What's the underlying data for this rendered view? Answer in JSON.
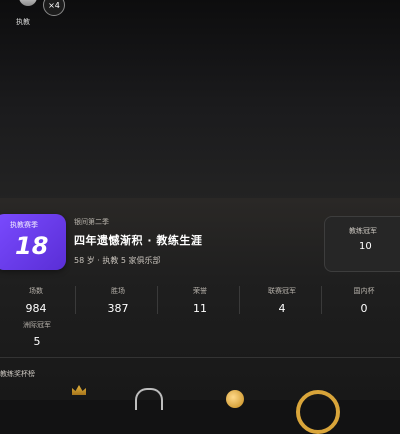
{
  "header": {
    "mini_label": "执教",
    "count_badge": "×4"
  },
  "card": {
    "featured_label": "执教赛季",
    "featured_value": "18",
    "subtitle": "银间第二季",
    "headline": "四年遗憾渐积 · 教练生涯",
    "meta": "58 岁 · 执教 5 家俱乐部",
    "champion_label": "教练冠军",
    "champion_value": "10"
  },
  "stats": [
    {
      "label": "场数",
      "value": "984"
    },
    {
      "label": "胜场",
      "value": "387"
    },
    {
      "label": "荣誉",
      "value": "11"
    },
    {
      "label": "联赛冠军",
      "value": "4"
    },
    {
      "label": "国内杯",
      "value": "0"
    }
  ],
  "extra_stat": {
    "label": "洲际冠军",
    "value": "5"
  },
  "honors": {
    "label": "教练奖杯榜"
  }
}
